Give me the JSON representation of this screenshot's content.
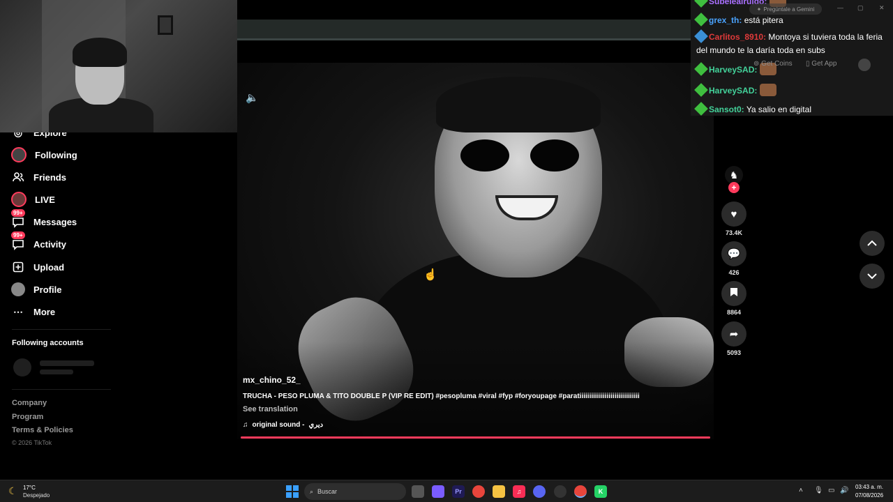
{
  "sidebar": {
    "items": [
      {
        "label": "Explore",
        "icon": "compass-icon",
        "badge": ""
      },
      {
        "label": "Following",
        "icon": "following-avatar-icon",
        "badge": ""
      },
      {
        "label": "Friends",
        "icon": "friends-icon",
        "badge": ""
      },
      {
        "label": "LIVE",
        "icon": "live-icon",
        "badge": ""
      },
      {
        "label": "Messages",
        "icon": "messages-icon",
        "badge": "99+"
      },
      {
        "label": "Activity",
        "icon": "activity-icon",
        "badge": "99+"
      },
      {
        "label": "Upload",
        "icon": "upload-icon",
        "badge": ""
      },
      {
        "label": "Profile",
        "icon": "profile-icon",
        "badge": ""
      },
      {
        "label": "More",
        "icon": "more-icon",
        "badge": ""
      }
    ],
    "following_accounts_title": "Following accounts",
    "footer": {
      "company": "Company",
      "program": "Program",
      "terms": "Terms & Policies",
      "copyright": "© 2026 TikTok"
    }
  },
  "video": {
    "author": "mx_chino_52_",
    "caption": "TRUCHA - PESO PLUMA & TITO DOUBLE P (VIP RE EDIT) #pesopluma #viral #fyp #foryoupage #paratiiiiiiiiiiiiiiiiiiiiiiiiiiiiiii",
    "see_translation": "See translation",
    "sound_prefix": "original sound - ",
    "sound_name": "ديري",
    "progress": 1.0
  },
  "actions": {
    "likes": "73.4K",
    "comments": "426",
    "saves": "8864",
    "shares": "5093"
  },
  "chat": {
    "messages": [
      {
        "user": "Subelealruido:",
        "text": "",
        "color": "#a970ff"
      },
      {
        "user": "grex_th:",
        "text": "está pitera",
        "color": "#4aa3ff"
      },
      {
        "user": "Carlitos_8910:",
        "text": "Montoya si tuviera toda la feria del mundo te la daría toda en subs",
        "color": "#e03a3a"
      },
      {
        "user": "HarveySAD:",
        "text": "",
        "color": "#43d29a"
      },
      {
        "user": "HarveySAD:",
        "text": "",
        "color": "#43d29a"
      },
      {
        "user": "Sansot0:",
        "text": "Ya salio en digital",
        "color": "#43d29a"
      }
    ],
    "gemini_pill": "Pregúntale a Gemini",
    "get_coins": "Get Coins",
    "get_app": "Get App"
  },
  "taskbar": {
    "temperature": "17°C",
    "weather": "Despejado",
    "search_placeholder": "Buscar",
    "time": "03:43 a. m.",
    "date": "07/08/2026"
  },
  "colors": {
    "accent": "#ff3b5c",
    "background": "#000000",
    "windows_blue": "#3aa0ff"
  }
}
